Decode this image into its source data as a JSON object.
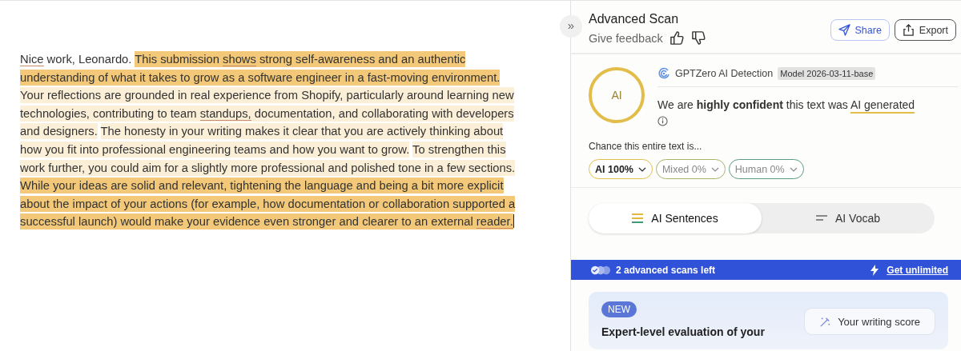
{
  "document": {
    "sentences": [
      {
        "kind": "plain",
        "segments": [
          {
            "text": "Nice",
            "underlined": true
          },
          {
            "text": " work, Leonardo.",
            "underlined": false
          }
        ]
      },
      {
        "kind": "strong",
        "segments": [
          {
            "text": "This submission ",
            "underlined": false
          },
          {
            "text": "shows",
            "underlined": true
          },
          {
            "text": " strong self-awareness and an authentic understanding of what it takes to grow as a software engineer in a fast-moving environment.",
            "underlined": false
          }
        ]
      },
      {
        "kind": "light",
        "segments": [
          {
            "text": "Your reflections are grounded in real experience from Shopify, particularly around learning new technologies, contributing to team ",
            "underlined": false
          },
          {
            "text": "standups,",
            "underlined": true
          },
          {
            "text": " documentation, and collaborating with developers and designers.",
            "underlined": false
          }
        ]
      },
      {
        "kind": "light",
        "segments": [
          {
            "text": "The honesty in your writing makes it clear that you are actively thinking about how you fit into professional engineering teams and how you want to grow.",
            "underlined": false
          }
        ]
      },
      {
        "kind": "light",
        "segments": [
          {
            "text": "To strengthen this work further, you could aim for a slightly more professional and polished tone in a few sections.",
            "underlined": false
          }
        ]
      },
      {
        "kind": "strong",
        "segments": [
          {
            "text": "While your ideas are solid and relevant, tightening the language and being a bit more explicit about the impact of your actions (for example, how documentation or collaboration supported a successful launch) would make your evidence even stronger and clearer to an external ",
            "underlined": false
          },
          {
            "text": "reader.",
            "underlined": true
          }
        ]
      }
    ]
  },
  "panel": {
    "collapse_button": "»",
    "title": "Advanced Scan",
    "feedback_label": "Give feedback",
    "buttons": [
      {
        "kind": "share",
        "label": "Share"
      },
      {
        "kind": "export",
        "label": "Export"
      }
    ],
    "result": {
      "ring_label": "AI",
      "detector": "GPTZero AI Detection",
      "model_badge": "Model 2026-03-11-base",
      "verdict": "We are **highly confident** this text was",
      "verdict_link": "AI generated",
      "chance_label": "Chance this entire text is...",
      "pills": [
        {
          "label": "AI 100%",
          "selected": true,
          "color": "#e2c04c"
        },
        {
          "label": "Mixed 0%",
          "selected": false,
          "color": "#a8b46c"
        },
        {
          "label": "Human 0%",
          "selected": false,
          "color": "#5e9c82"
        }
      ]
    },
    "tabs": [
      {
        "label": "AI Sentences",
        "selected": true,
        "kind": "sentences"
      },
      {
        "label": "AI Vocab",
        "selected": false,
        "kind": "vocab"
      }
    ],
    "banner": {
      "text": "2 advanced scans left",
      "link": "Get unlimited"
    },
    "promo": {
      "badge": "NEW",
      "heading": "Expert-level evaluation of your",
      "button": "Your writing score"
    }
  }
}
